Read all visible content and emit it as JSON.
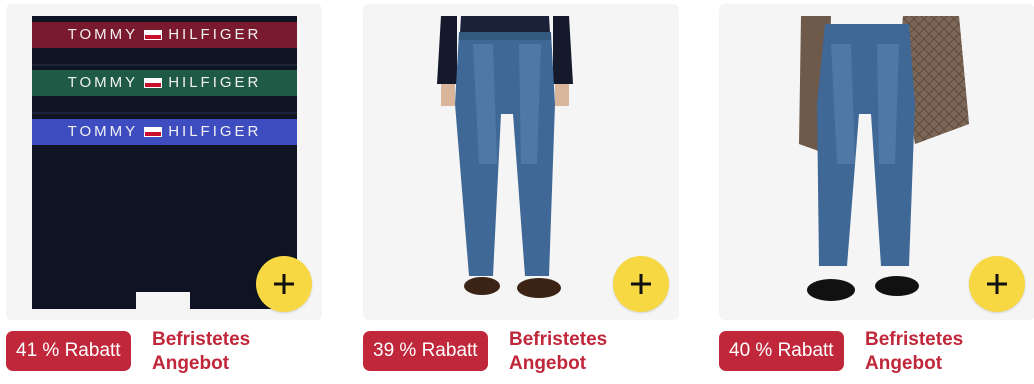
{
  "products": [
    {
      "brand_band": {
        "left": "TOMMY",
        "right": "HILFIGER"
      },
      "discount_badge": "41 % Rabatt",
      "deal_label_line1": "Befristetes",
      "deal_label_line2": "Angebot",
      "add_icon": "plus-icon"
    },
    {
      "discount_badge": "39 % Rabatt",
      "deal_label_line1": "Befristetes",
      "deal_label_line2": "Angebot",
      "add_icon": "plus-icon"
    },
    {
      "discount_badge": "40 % Rabatt",
      "deal_label_line1": "Befristetes",
      "deal_label_line2": "Angebot",
      "add_icon": "plus-icon"
    }
  ],
  "colors": {
    "badge_bg": "#c0273a",
    "deal_text": "#c0273a",
    "add_button": "#f7d843",
    "tile_bg": "#f5f5f5"
  }
}
